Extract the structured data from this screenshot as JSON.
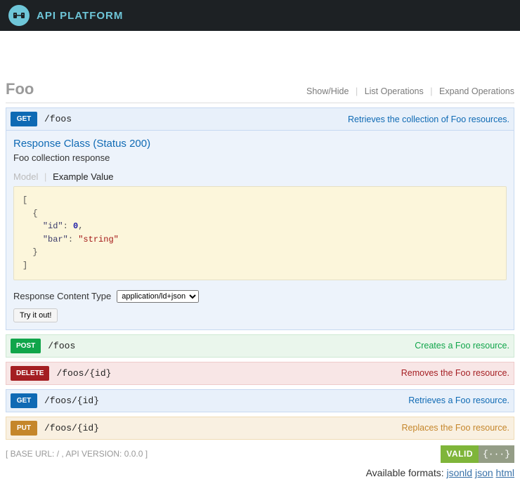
{
  "brand": "API PLATFORM",
  "resource": {
    "name": "Foo",
    "links": {
      "show_hide": "Show/Hide",
      "list_ops": "List Operations",
      "expand_ops": "Expand Operations"
    }
  },
  "operations": [
    {
      "method": "GET",
      "path": "/foos",
      "summary": "Retrieves the collection of Foo resources.",
      "expanded": true,
      "response": {
        "title": "Response Class (Status 200)",
        "subtitle": "Foo collection response",
        "tabs": {
          "model": "Model",
          "example": "Example Value"
        },
        "example": "[\n  {\n    \"id\": 0,\n    \"bar\": \"string\"\n  }\n]",
        "content_type_label": "Response Content Type",
        "content_type_value": "application/ld+json",
        "try_label": "Try it out!"
      }
    },
    {
      "method": "POST",
      "path": "/foos",
      "summary": "Creates a Foo resource."
    },
    {
      "method": "DELETE",
      "path": "/foos/{id}",
      "summary": "Removes the Foo resource."
    },
    {
      "method": "GET",
      "path": "/foos/{id}",
      "summary": "Retrieves a Foo resource."
    },
    {
      "method": "PUT",
      "path": "/foos/{id}",
      "summary": "Replaces the Foo resource."
    }
  ],
  "footer": {
    "base_url": "[ BASE URL: / , API VERSION: 0.0.0 ]",
    "valid": "VALID",
    "valid_icon": "{···}",
    "formats_label": "Available formats:",
    "formats": [
      "jsonld",
      "json",
      "html"
    ]
  }
}
